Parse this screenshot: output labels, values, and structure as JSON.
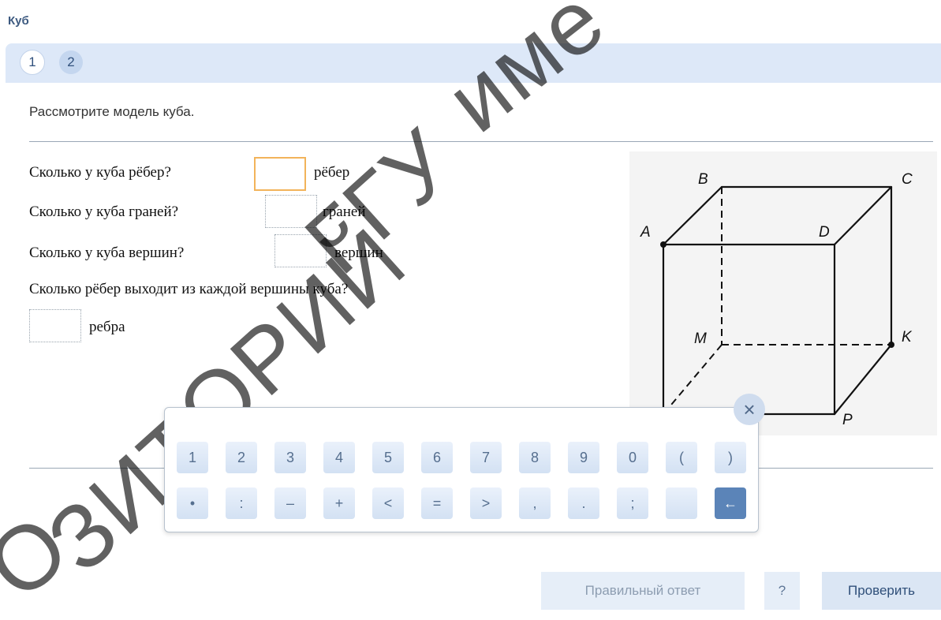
{
  "title": "Куб",
  "steps": [
    "1",
    "2"
  ],
  "intro": "Рассмотрите модель куба.",
  "questions": {
    "q1": {
      "text": "Сколько у куба рёбер?",
      "value": "",
      "unit": "рёбер"
    },
    "q2": {
      "text": "Сколько у куба граней?",
      "value": "",
      "unit": "граней"
    },
    "q3": {
      "text": "Сколько у куба вершин?",
      "value": "",
      "unit": "вершин"
    },
    "q4": {
      "text": "Сколько рёбер выходит из каждой вершины куба?",
      "value": "",
      "unit": "ребра"
    }
  },
  "cube_labels": {
    "B": "B",
    "C": "C",
    "A": "A",
    "D": "D",
    "M": "M",
    "K": "K",
    "P": "P"
  },
  "keypad": {
    "row1": [
      "1",
      "2",
      "3",
      "4",
      "5",
      "6",
      "7",
      "8",
      "9",
      "0",
      "(",
      ")"
    ],
    "row2": [
      "•",
      ":",
      "–",
      "+",
      "<",
      "=",
      ">",
      ",",
      ".",
      ";",
      "",
      "←"
    ],
    "close": "×"
  },
  "buttons": {
    "answer": "Правильный ответ",
    "help": "?",
    "check": "Проверить"
  },
  "watermark": {
    "line1": "име",
    "line2": "ГГУ",
    "line3": "ОРИЙ",
    "line4": "ЗИТ",
    "line5": "О"
  },
  "colors": {
    "accent": "#3d5a80",
    "input_active": "#f2b35a",
    "stepbar": "#dde8f8",
    "backspace": "#5b84b8"
  },
  "icons": {
    "close": "close-icon",
    "backspace": "backspace-arrow-icon"
  }
}
